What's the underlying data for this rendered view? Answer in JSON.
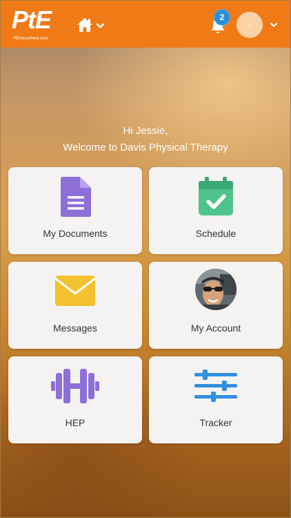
{
  "header": {
    "logo_text": "PtE",
    "logo_subtext": "PtEverywhere.com",
    "home_icon": "home-icon",
    "notifications_count": "2",
    "avatar_initial": "-",
    "brand_color": "#f07a16"
  },
  "greeting": {
    "line1": "Hi Jessie,",
    "line2": "Welcome to Davis Physical Therapy"
  },
  "tiles": [
    {
      "label": "My Documents",
      "icon": "document-icon",
      "color": "#8e6fd8"
    },
    {
      "label": "Schedule",
      "icon": "calendar-check-icon",
      "color": "#4fc48a"
    },
    {
      "label": "Messages",
      "icon": "envelope-icon",
      "color": "#f2c230"
    },
    {
      "label": "My Account",
      "icon": "profile-photo",
      "color": "#6b6b6b"
    },
    {
      "label": "HEP",
      "icon": "dumbbell-icon",
      "color": "#8e6fd8"
    },
    {
      "label": "Tracker",
      "icon": "sliders-icon",
      "color": "#2f8fe0"
    }
  ]
}
